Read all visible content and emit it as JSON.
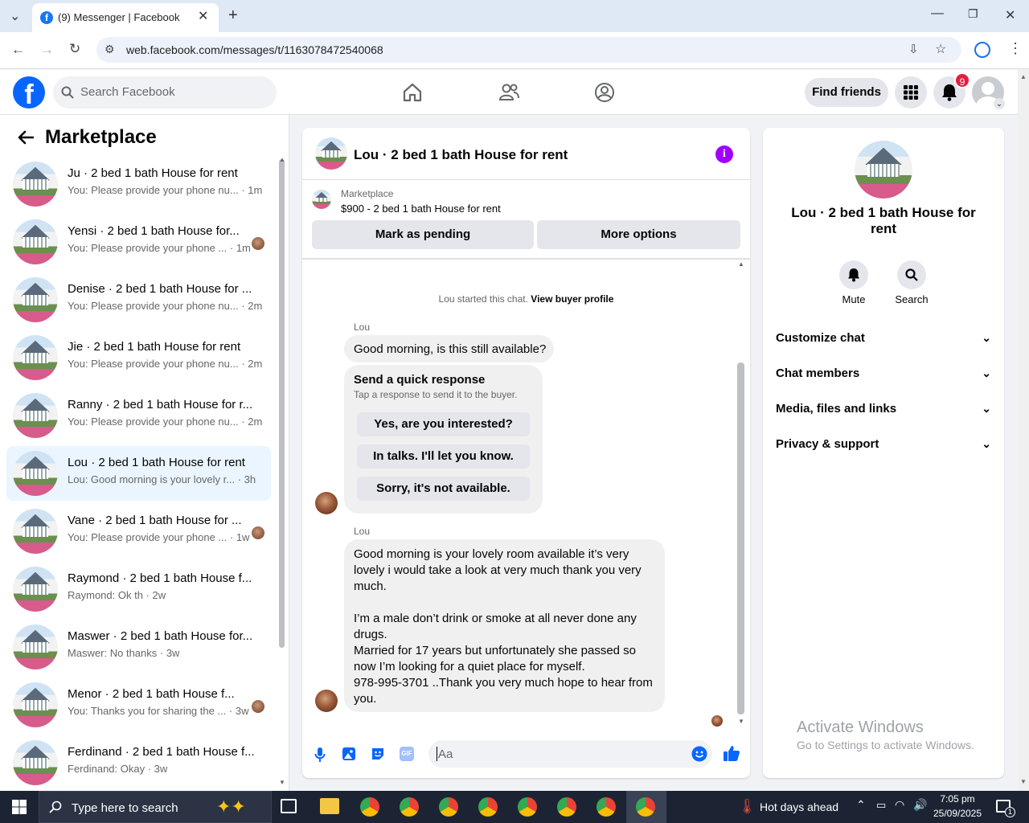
{
  "browser": {
    "tab_title": "(9) Messenger | Facebook",
    "url": "web.facebook.com/messages/t/1163078472540068"
  },
  "fb": {
    "search_placeholder": "Search Facebook",
    "find_friends": "Find friends",
    "notification_count": "9"
  },
  "sidebar": {
    "title": "Marketplace",
    "conversations": [
      {
        "title": "Ju · 2 bed 1 bath House for rent",
        "preview": "You: Please provide your phone nu... · 1m",
        "active": false,
        "seen_avatar": false
      },
      {
        "title": "Yensi · 2 bed 1 bath House for...",
        "preview": "You: Please provide your phone ... · 1m",
        "active": false,
        "seen_avatar": true
      },
      {
        "title": "Denise · 2 bed 1 bath House for ...",
        "preview": "You: Please provide your phone nu... · 2m",
        "active": false,
        "seen_avatar": false
      },
      {
        "title": "Jie · 2 bed 1 bath House for rent",
        "preview": "You: Please provide your phone nu... · 2m",
        "active": false,
        "seen_avatar": false
      },
      {
        "title": "Ranny · 2 bed 1 bath House for r...",
        "preview": "You: Please provide your phone nu... · 2m",
        "active": false,
        "seen_avatar": false
      },
      {
        "title": "Lou · 2 bed 1 bath House for rent",
        "preview": "Lou: Good morning is your lovely r... · 3h",
        "active": true,
        "seen_avatar": false
      },
      {
        "title": "Vane · 2 bed 1 bath House for ...",
        "preview": "You: Please provide your phone ... · 1w",
        "active": false,
        "seen_avatar": true
      },
      {
        "title": "Raymond · 2 bed 1 bath House f...",
        "preview": "Raymond: Ok th · 2w",
        "active": false,
        "seen_avatar": false
      },
      {
        "title": "Maswer · 2 bed 1 bath House for...",
        "preview": "Maswer: No thanks · 3w",
        "active": false,
        "seen_avatar": false
      },
      {
        "title": "Menor · 2 bed 1 bath House f...",
        "preview": "You: Thanks you for sharing the ... · 3w",
        "active": false,
        "seen_avatar": true
      },
      {
        "title": "Ferdinand · 2 bed 1 bath House f...",
        "preview": "Ferdinand: Okay · 3w",
        "active": false,
        "seen_avatar": false
      }
    ]
  },
  "chat": {
    "title": "Lou · 2 bed 1 bath House for rent",
    "listing_label": "Marketplace",
    "listing_price": "$900 - 2 bed 1 bath House for rent",
    "mark_pending": "Mark as pending",
    "more_options": "More options",
    "started_text": "Lou started this chat.",
    "view_buyer": "View buyer profile",
    "sender": "Lou",
    "msg1": "Good morning, is this still available?",
    "quick_title": "Send a quick response",
    "quick_sub": "Tap a response to send it to the buyer.",
    "quick_responses": [
      "Yes, are you interested?",
      "In talks. I'll let you know.",
      "Sorry, it's not available."
    ],
    "msg2_lines": [
      "Good morning is your lovely room available it’s very",
      "lovely i would take a look at very much thank you very",
      "much.",
      "",
      "I’m a male don’t drink or smoke at all never done any",
      "drugs.",
      "Married for 17 years but unfortunately she passed so",
      "now I’m looking for a quiet place for myself.",
      "978-995-3701  ..Thank you very much hope to hear from",
      "you."
    ],
    "input_placeholder": "Aa"
  },
  "info_panel": {
    "title": "Lou · 2 bed 1 bath House for rent",
    "mute": "Mute",
    "search": "Search",
    "sections": [
      "Customize chat",
      "Chat members",
      "Media, files and links",
      "Privacy & support"
    ]
  },
  "watermark": {
    "line1": "Activate Windows",
    "line2": "Go to Settings to activate Windows."
  },
  "taskbar": {
    "search_placeholder": "Type here to search",
    "weather": "Hot days ahead",
    "time": "7:05 pm",
    "date": "25/09/2025",
    "notif_count": "1"
  }
}
